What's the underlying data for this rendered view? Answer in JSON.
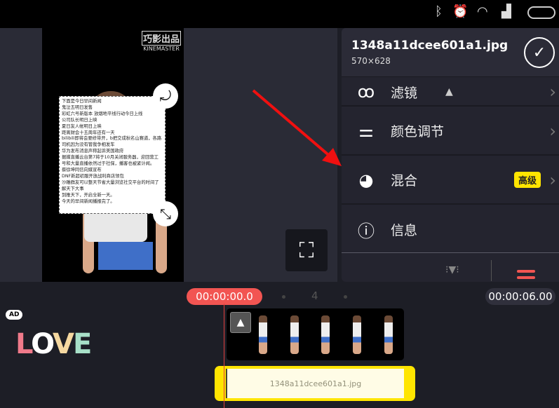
{
  "status_bar": {
    "icons": [
      "bluetooth-icon",
      "alarm-icon",
      "wifi-icon",
      "signal-icon",
      "battery-icon"
    ]
  },
  "preview": {
    "watermark": {
      "top": "巧影出品",
      "bottom": "KINEMASTER"
    },
    "note_lines": [
      "下面是今日早间新闻",
      "鬼泣五明日发售",
      "彩虹六号新版本 放烟地平线行动今日上线",
      "公司队长明日上映",
      "夏日友人帐明日上映",
      "距离财会十五周年还有一天",
      "bilibili即将会要修带开，b把交成秋名山赛道，各路司机因为没有管我争相发车",
      "华为发布消息声称起诉美国政府",
      "据媒直播云台第7将于10月关闭服务器，迎回营工号和大量直播依然过于社保，播客也被紧计闻。",
      "蔡徐坤同信向媒宣布",
      "DNF新超初服开放战利商店领包",
      "沙雕群友可以整天节省大量浏览社交平台的时间了解天下大事",
      "到推天下，开启全新一天。",
      "今天的早间新闻播报完了。"
    ]
  },
  "panel": {
    "filename": "1348a11dcee601a1.jpg",
    "dimensions": "570×628",
    "items": [
      {
        "label": "滤镜",
        "icon": "filter-icon"
      },
      {
        "label": "颜色调节",
        "icon": "sliders-icon"
      },
      {
        "label": "混合",
        "icon": "blend-icon",
        "badge": "高级"
      },
      {
        "label": "信息",
        "icon": "info-icon"
      }
    ]
  },
  "timeline": {
    "current_time": "00:00:00.0",
    "page": "4",
    "end_time": "00:00:06.00",
    "clip_label": "1348a11dcee601a1.jpg"
  },
  "sticker": {
    "ad": "AD",
    "love": "LOVE"
  },
  "colors": {
    "accent": "#f25552",
    "badge": "#ffe500",
    "panel": "#24242f"
  }
}
